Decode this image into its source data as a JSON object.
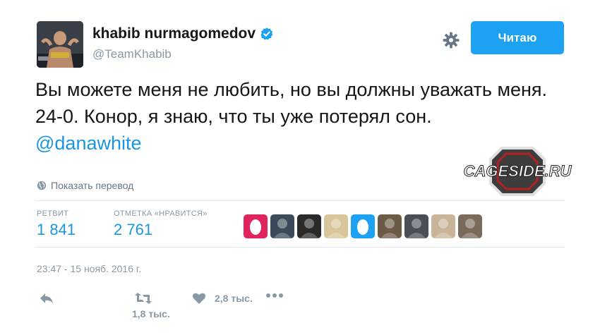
{
  "user": {
    "display_name": "khabib nurmagomedov",
    "handle": "@TeamKhabib",
    "verified": true
  },
  "follow_button": {
    "label": "Читаю"
  },
  "tweet": {
    "text": "Вы можете меня не любить, но вы должны уважать меня. 24-0. Конор, я знаю, что ты уже потерял сон.",
    "mention": "@danawhite",
    "translate_label": "Показать перевод",
    "timestamp": "23:47 - 15 нояб. 2016 г."
  },
  "stats": {
    "retweets_label": "РЕТВИТ",
    "retweets_value": "1 841",
    "likes_label": "ОТМЕТКА «НРАВИТСЯ»",
    "likes_value": "2 761"
  },
  "likers": [
    {
      "name": "liker-avatar-pink-egg",
      "color": "#e0245e"
    },
    {
      "name": "liker-avatar-dark",
      "color": "#3b4a5a"
    },
    {
      "name": "liker-avatar-portrait",
      "color": "#2a2a2a"
    },
    {
      "name": "liker-avatar-blond",
      "color": "#d8c59a"
    },
    {
      "name": "liker-avatar-blue-egg",
      "color": "#1da1f2"
    },
    {
      "name": "liker-avatar-man",
      "color": "#6b5a45"
    },
    {
      "name": "liker-avatar-logo",
      "color": "#4a4f55"
    },
    {
      "name": "liker-avatar-woman",
      "color": "#c9b49a"
    },
    {
      "name": "liker-avatar-fighter",
      "color": "#7a6a5a"
    }
  ],
  "actions": {
    "retweet_count": "1,8 тыс.",
    "like_count": "2,8 тыс."
  },
  "watermark_text": "CAGESIDE.RU",
  "colors": {
    "accent": "#1da1f2",
    "link": "#1b95e0",
    "muted": "#8899a6"
  }
}
